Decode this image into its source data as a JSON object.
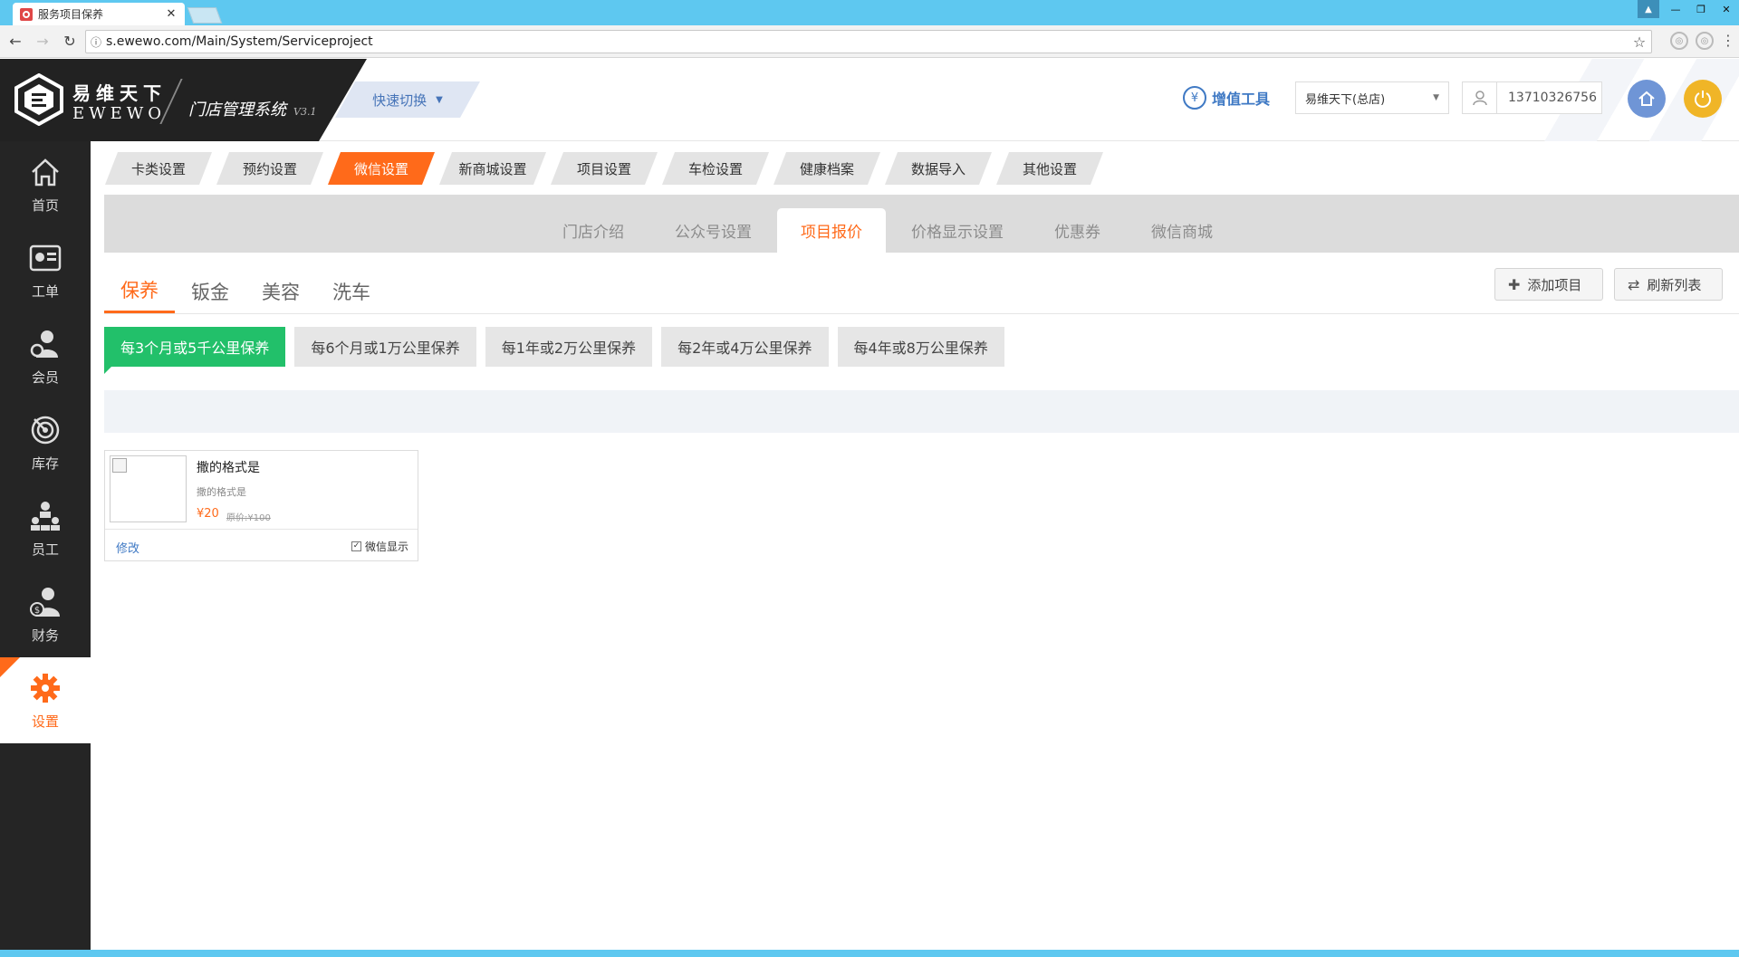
{
  "browser": {
    "tab_title": "服务项目保养",
    "url": "s.ewewo.com/Main/System/Serviceproject"
  },
  "header": {
    "brand_cn": "易维天下",
    "brand_en": "EWEWO",
    "system_name": "门店管理系统",
    "version": "V3.1",
    "quick_switch": "快速切换",
    "value_tools": "增值工具",
    "store": "易维天下(总店)",
    "phone": "13710326756"
  },
  "sidebar": {
    "items": [
      {
        "label": "首页",
        "icon": "home-icon"
      },
      {
        "label": "工单",
        "icon": "work-order-icon"
      },
      {
        "label": "会员",
        "icon": "member-icon"
      },
      {
        "label": "库存",
        "icon": "inventory-icon"
      },
      {
        "label": "员工",
        "icon": "staff-icon"
      },
      {
        "label": "财务",
        "icon": "finance-icon"
      },
      {
        "label": "设置",
        "icon": "gear-icon",
        "active": true
      }
    ]
  },
  "settings_tabs": [
    "卡类设置",
    "预约设置",
    "微信设置",
    "新商城设置",
    "项目设置",
    "车检设置",
    "健康档案",
    "数据导入",
    "其他设置"
  ],
  "subnav": [
    "门店介绍",
    "公众号设置",
    "项目报价",
    "价格显示设置",
    "优惠券",
    "微信商城"
  ],
  "categories": [
    "保养",
    "钣金",
    "美容",
    "洗车"
  ],
  "actions": {
    "add": "添加项目",
    "refresh": "刷新列表"
  },
  "intervals": [
    "每3个月或5千公里保养",
    "每6个月或1万公里保养",
    "每1年或2万公里保养",
    "每2年或4万公里保养",
    "每4年或8万公里保养"
  ],
  "project": {
    "title": "撒的格式是",
    "subtitle": "撒的格式是",
    "price": "¥20",
    "original_price": "原价:¥100",
    "edit": "修改",
    "wechat_display": "微信显示",
    "wechat_checked": true
  },
  "colors": {
    "accent": "#ff6a1a",
    "green": "#22c06a",
    "sidebar": "#252525",
    "link": "#3f79c4"
  }
}
